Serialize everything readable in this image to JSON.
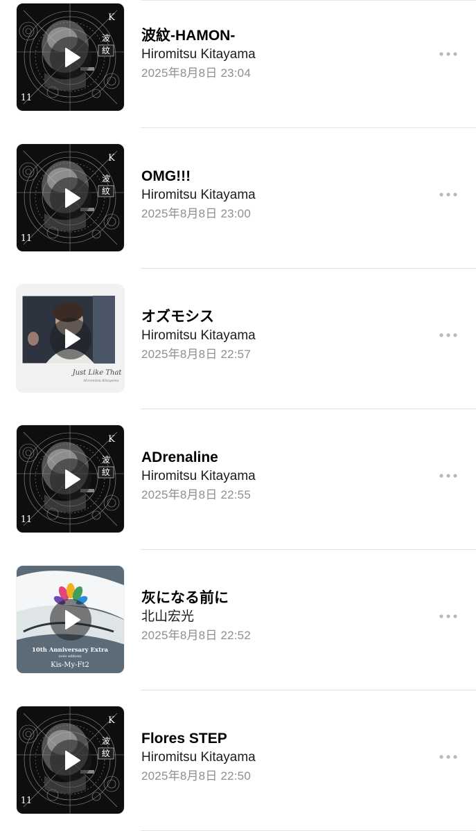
{
  "songs": [
    {
      "title": "波紋-HAMON-",
      "artist": "Hiromitsu Kitayama",
      "date": "2025年8月8日 23:04",
      "art": "hamon"
    },
    {
      "title": "OMG!!!",
      "artist": "Hiromitsu Kitayama",
      "date": "2025年8月8日 23:00",
      "art": "hamon"
    },
    {
      "title": "オズモシス",
      "artist": "Hiromitsu Kitayama",
      "date": "2025年8月8日 22:57",
      "art": "just-like-that",
      "art_text": "Just Like That"
    },
    {
      "title": "ADrenaline",
      "artist": "Hiromitsu Kitayama",
      "date": "2025年8月8日 22:55",
      "art": "hamon"
    },
    {
      "title": "灰になる前に",
      "artist": "北山宏光",
      "date": "2025年8月8日 22:52",
      "art": "anniversary",
      "art_text": "10th Anniversary Extra",
      "art_subtext": "(solo edition)",
      "art_band": "Kis-My-Ft2"
    },
    {
      "title": "Flores STEP",
      "artist": "Hiromitsu Kitayama",
      "date": "2025年8月8日 22:50",
      "art": "hamon"
    }
  ],
  "icons": {
    "play": "play-icon",
    "more": "more-icon"
  },
  "colors": {
    "date_gray": "#8e8e93",
    "separator": "#e2e2e6"
  }
}
